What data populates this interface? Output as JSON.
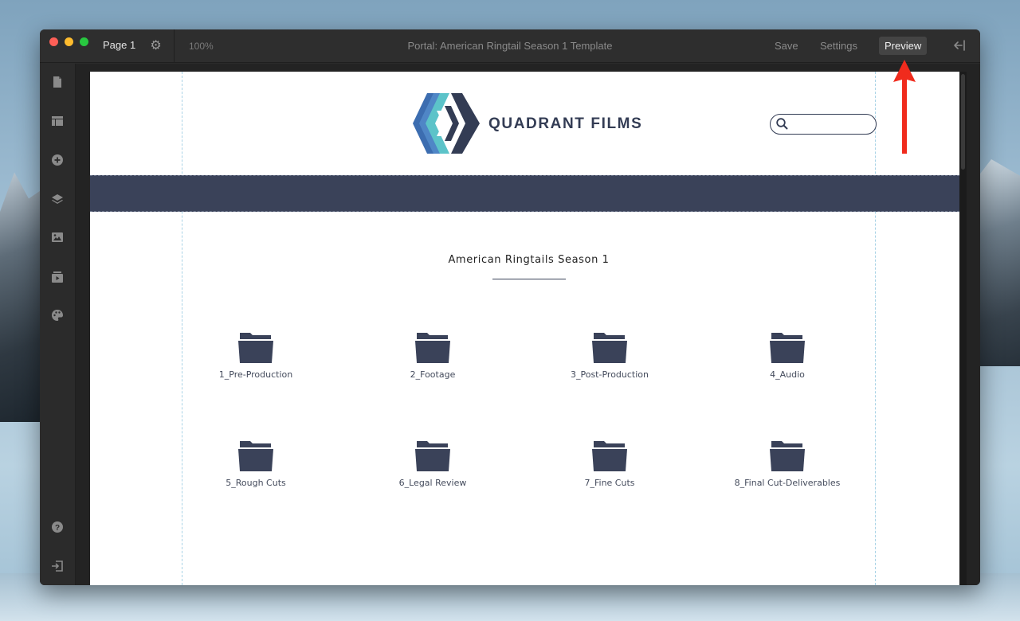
{
  "window": {
    "page_name": "Page 1",
    "zoom": "100%",
    "doc_title": "Portal: American Ringtail Season 1 Template",
    "toolbar": {
      "save_label": "Save",
      "settings_label": "Settings",
      "preview_label": "Preview"
    }
  },
  "sidebar": {
    "items": [
      {
        "name": "pages",
        "icon": "document-icon"
      },
      {
        "name": "layout",
        "icon": "layout-icon"
      },
      {
        "name": "add",
        "icon": "plus-circle-icon"
      },
      {
        "name": "layers",
        "icon": "layers-icon"
      },
      {
        "name": "images",
        "icon": "image-icon"
      },
      {
        "name": "media",
        "icon": "media-icon"
      },
      {
        "name": "theme",
        "icon": "palette-icon"
      },
      {
        "name": "help",
        "icon": "help-icon"
      },
      {
        "name": "logout",
        "icon": "logout-icon"
      }
    ]
  },
  "portal": {
    "brand": "QUADRANT FILMS",
    "section_title": "American Ringtails Season 1",
    "folders": [
      {
        "label": "1_Pre-Production"
      },
      {
        "label": "2_Footage"
      },
      {
        "label": "3_Post-Production"
      },
      {
        "label": "4_Audio"
      },
      {
        "label": "5_Rough Cuts"
      },
      {
        "label": "6_Legal Review"
      },
      {
        "label": "7_Fine Cuts"
      },
      {
        "label": "8_Final Cut-Deliverables"
      }
    ]
  },
  "colors": {
    "navy": "#3a4259",
    "logo_teal": "#5cc3c9",
    "logo_blue": "#3c6db0",
    "arrow_red": "#f02b1d"
  }
}
